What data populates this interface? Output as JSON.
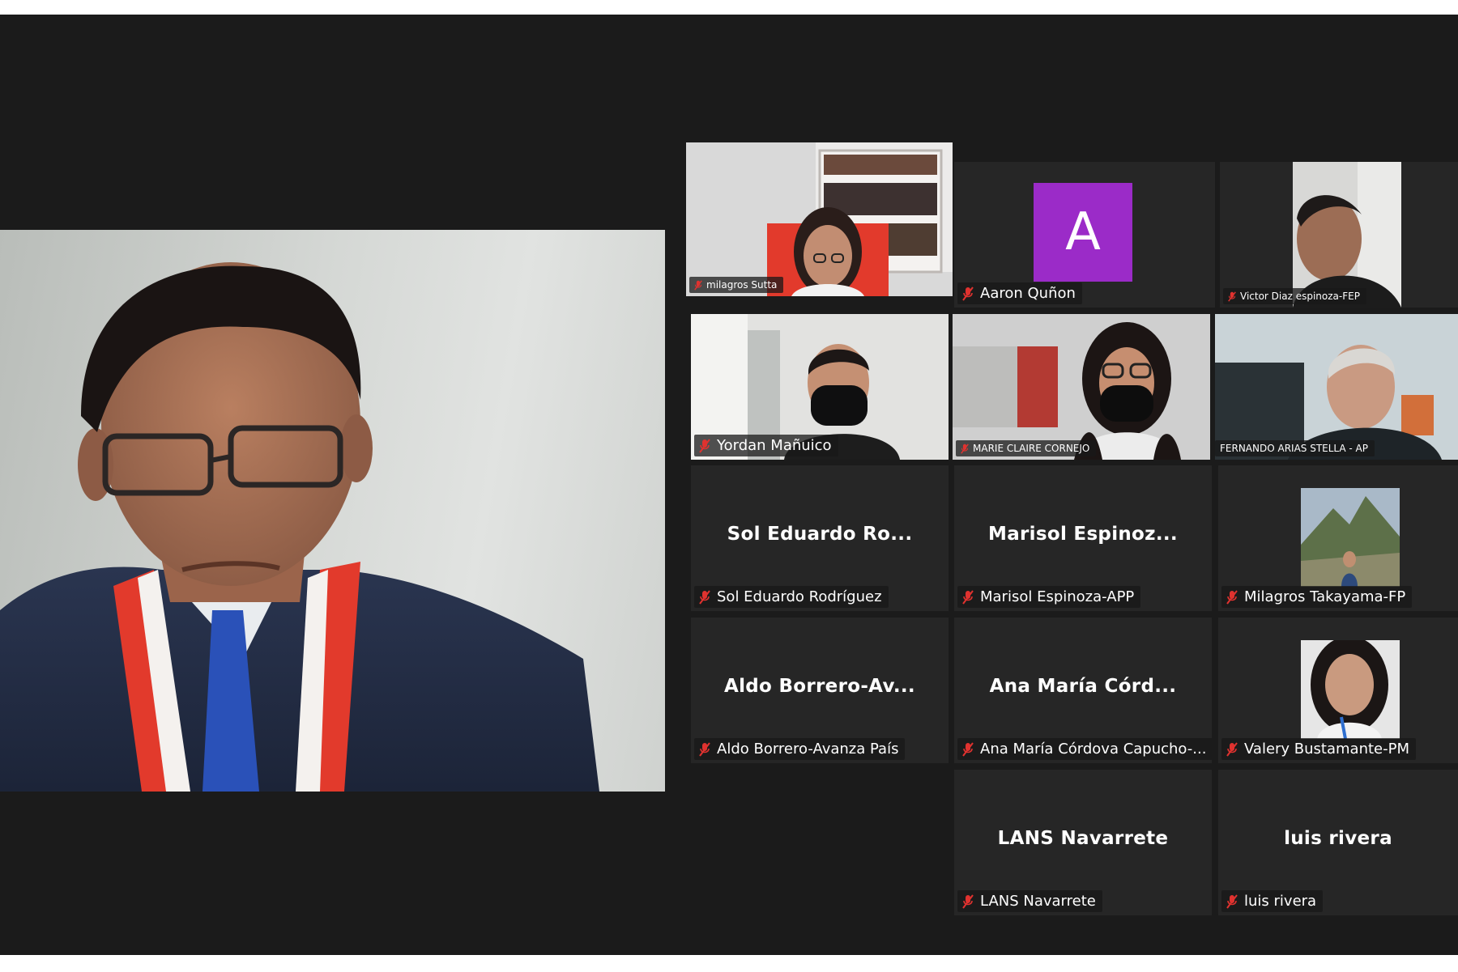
{
  "meeting": {
    "speaker": {
      "name": ""
    },
    "participants": [
      {
        "id": "milagros-sutta",
        "tag": "milagros Sutta",
        "display_name": "",
        "video": true,
        "muted": true
      },
      {
        "id": "aaron-qunon",
        "tag": "Aaron Quñon",
        "display_name": "",
        "avatar_letter": "A",
        "avatar_color": "#9b2bc8",
        "muted": true
      },
      {
        "id": "victor-diaz",
        "tag": "Victor Diaz espinoza-FEP",
        "display_name": "",
        "video": true,
        "muted": true
      },
      {
        "id": "yordan-manuico",
        "tag": "Yordan Mañuico",
        "display_name": "",
        "video": true,
        "muted": true
      },
      {
        "id": "marie-claire",
        "tag": "MARIE CLAIRE CORNEJO",
        "display_name": "",
        "video": true,
        "muted": true
      },
      {
        "id": "fernando-arias",
        "tag": "FERNANDO ARIAS STELLA - AP",
        "display_name": "",
        "video": true,
        "muted": false
      },
      {
        "id": "sol-eduardo",
        "tag": "Sol Eduardo Rodríguez",
        "display_name": "Sol Eduardo Ro...",
        "muted": true
      },
      {
        "id": "marisol-espinoza",
        "tag": "Marisol Espinoza-APP",
        "display_name": "Marisol Espinoz...",
        "muted": true
      },
      {
        "id": "milagros-takayama",
        "tag": "Milagros Takayama-FP",
        "display_name": "",
        "profile_photo": true,
        "muted": true
      },
      {
        "id": "aldo-borrero",
        "tag": "Aldo Borrero-Avanza País",
        "display_name": "Aldo Borrero-Av...",
        "muted": true
      },
      {
        "id": "ana-maria-cordova",
        "tag": "Ana María Córdova Capucho-...",
        "display_name": "Ana María Córd...",
        "muted": true
      },
      {
        "id": "valery-bustamante",
        "tag": "Valery Bustamante-PM",
        "display_name": "",
        "profile_photo": true,
        "muted": true
      },
      {
        "id": "lans-navarrete",
        "tag": "LANS Navarrete",
        "display_name": "LANS Navarrete",
        "muted": true
      },
      {
        "id": "luis-rivera",
        "tag": "luis rivera",
        "display_name": "luis rivera",
        "muted": true
      }
    ]
  },
  "colors": {
    "stage": "#1b1b1b",
    "tile": "#262626",
    "muted_icon": "#e0322f",
    "avatar": "#9b2bc8"
  }
}
